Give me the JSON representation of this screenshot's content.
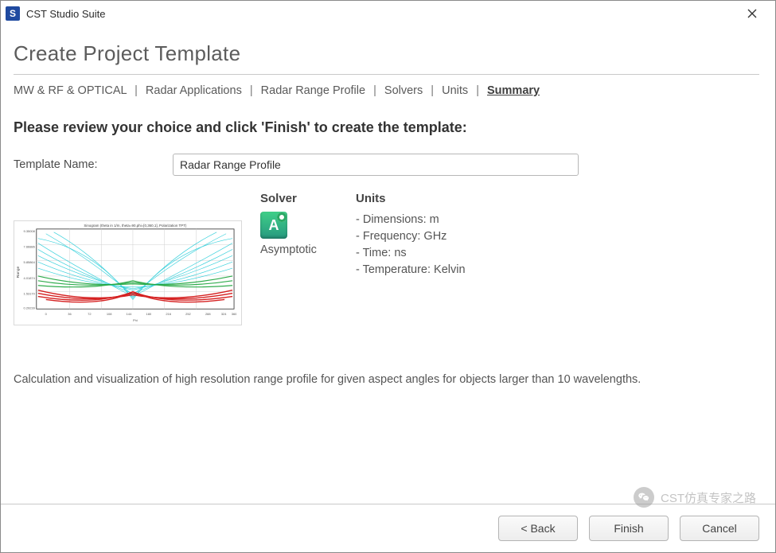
{
  "window": {
    "title": "CST Studio Suite"
  },
  "page_title": "Create Project Template",
  "breadcrumbs": {
    "items": [
      "MW & RF & OPTICAL",
      "Radar Applications",
      "Radar Range Profile",
      "Solvers",
      "Units",
      "Summary"
    ],
    "active_index": 5
  },
  "section_heading": "Please review your choice and click 'Finish' to create the template:",
  "form": {
    "template_name_label": "Template Name:",
    "template_name_value": "Radar Range Profile"
  },
  "solver": {
    "heading": "Solver",
    "icon_letter": "A",
    "icon_name": "asymptotic-solver-icon",
    "name": "Asymptotic"
  },
  "units": {
    "heading": "Units",
    "items": [
      "- Dimensions: m",
      "- Frequency: GHz",
      "- Time: ns",
      "- Temperature: Kelvin"
    ]
  },
  "description": "Calculation and visualization of high resolution range profile for given aspect angles for objects larger than 10 wavelengths.",
  "buttons": {
    "back": "< Back",
    "finish": "Finish",
    "cancel": "Cancel"
  },
  "watermark": "CST仿真专家之路"
}
